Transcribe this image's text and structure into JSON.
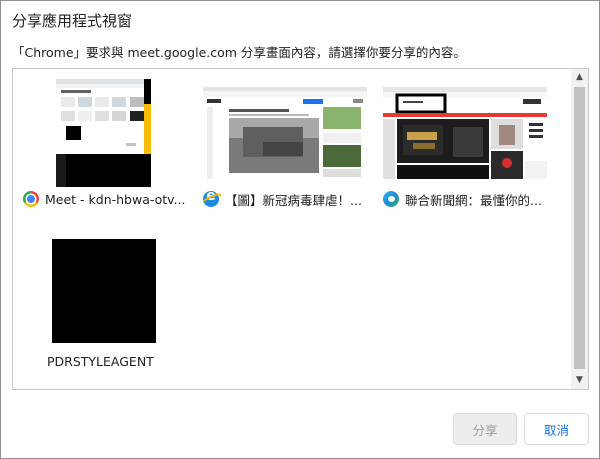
{
  "dialog": {
    "title": "分享應用程式視窗",
    "subtitle": "「Chrome」要求與 meet.google.com 分享畫面內容，請選擇你要分享的內容。"
  },
  "windows": [
    {
      "label": "Meet - kdn-hbwa-otv...",
      "icon": "chrome-icon"
    },
    {
      "label": "【圖】新冠病毒肆虐！...",
      "icon": "internet-explorer-icon"
    },
    {
      "label": "聯合新聞網：最懂你的...",
      "icon": "edge-icon"
    },
    {
      "label": "PDRSTYLEAGENT",
      "icon": ""
    }
  ],
  "buttons": {
    "share": "分享",
    "cancel": "取消"
  },
  "colors": {
    "accent": "#1a73e8",
    "disabled_text": "#9aa0a6"
  }
}
